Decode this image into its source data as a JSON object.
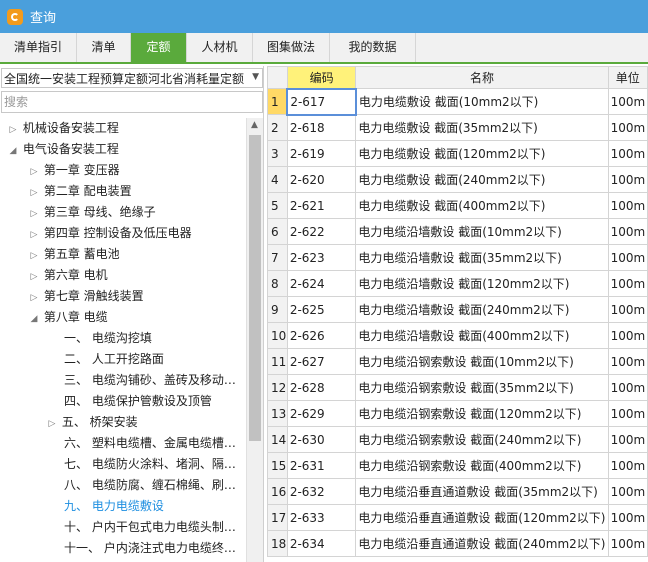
{
  "window": {
    "title": "查询"
  },
  "tabs": [
    {
      "label": "清单指引",
      "active": false
    },
    {
      "label": "清单",
      "active": false
    },
    {
      "label": "定额",
      "active": true
    },
    {
      "label": "人材机",
      "active": false
    },
    {
      "label": "图集做法",
      "active": false
    },
    {
      "label": "我的数据",
      "active": false
    }
  ],
  "left": {
    "combo_value": "全国统一安装工程预算定额河北省消耗量定额",
    "search_placeholder": "搜索",
    "tree": [
      {
        "label": "机械设备安装工程",
        "level": 0,
        "arrow": "▷"
      },
      {
        "label": "电气设备安装工程",
        "level": 0,
        "arrow": "◢"
      },
      {
        "label": "第一章  变压器",
        "level": 1,
        "arrow": "▷"
      },
      {
        "label": "第二章  配电装置",
        "level": 1,
        "arrow": "▷"
      },
      {
        "label": "第三章  母线、绝缘子",
        "level": 1,
        "arrow": "▷"
      },
      {
        "label": "第四章  控制设备及低压电器",
        "level": 1,
        "arrow": "▷"
      },
      {
        "label": "第五章  蓄电池",
        "level": 1,
        "arrow": "▷"
      },
      {
        "label": "第六章  电机",
        "level": 1,
        "arrow": "▷"
      },
      {
        "label": "第七章  滑触线装置",
        "level": 1,
        "arrow": "▷"
      },
      {
        "label": "第八章  电缆",
        "level": 1,
        "arrow": "◢"
      },
      {
        "label": "一、  电缆沟挖填",
        "level": 2,
        "arrow": ""
      },
      {
        "label": "二、  人工开挖路面",
        "level": 2,
        "arrow": ""
      },
      {
        "label": "三、  电缆沟铺砂、盖砖及移动…",
        "level": 2,
        "arrow": ""
      },
      {
        "label": "四、  电缆保护管敷设及顶管",
        "level": 2,
        "arrow": ""
      },
      {
        "label": "五、  桥架安装",
        "level": 2,
        "arrow": "▷"
      },
      {
        "label": "六、  塑料电缆槽、金属电缆槽…",
        "level": 2,
        "arrow": ""
      },
      {
        "label": "七、  电缆防火涂料、堵洞、隔…",
        "level": 2,
        "arrow": ""
      },
      {
        "label": "八、  电缆防腐、缠石棉绳、刷…",
        "level": 2,
        "arrow": ""
      },
      {
        "label": "九、  电力电缆敷设",
        "level": 2,
        "arrow": "",
        "selected": true
      },
      {
        "label": "十、  户内干包式电力电缆头制…",
        "level": 2,
        "arrow": ""
      },
      {
        "label": "十一、  户内浇注式电力电缆终…",
        "level": 2,
        "arrow": ""
      }
    ]
  },
  "grid": {
    "headers": {
      "rownum": "",
      "code": "编码",
      "name": "名称",
      "unit": "单位"
    },
    "rows": [
      {
        "n": "1",
        "code": "2-617",
        "name": "电力电缆敷设 截面(10mm2以下)",
        "unit": "100m",
        "active": true
      },
      {
        "n": "2",
        "code": "2-618",
        "name": "电力电缆敷设 截面(35mm2以下)",
        "unit": "100m"
      },
      {
        "n": "3",
        "code": "2-619",
        "name": "电力电缆敷设 截面(120mm2以下)",
        "unit": "100m"
      },
      {
        "n": "4",
        "code": "2-620",
        "name": "电力电缆敷设 截面(240mm2以下)",
        "unit": "100m"
      },
      {
        "n": "5",
        "code": "2-621",
        "name": "电力电缆敷设 截面(400mm2以下)",
        "unit": "100m"
      },
      {
        "n": "6",
        "code": "2-622",
        "name": "电力电缆沿墙敷设 截面(10mm2以下)",
        "unit": "100m"
      },
      {
        "n": "7",
        "code": "2-623",
        "name": "电力电缆沿墙敷设 截面(35mm2以下)",
        "unit": "100m"
      },
      {
        "n": "8",
        "code": "2-624",
        "name": "电力电缆沿墙敷设 截面(120mm2以下)",
        "unit": "100m"
      },
      {
        "n": "9",
        "code": "2-625",
        "name": "电力电缆沿墙敷设 截面(240mm2以下)",
        "unit": "100m"
      },
      {
        "n": "10",
        "code": "2-626",
        "name": "电力电缆沿墙敷设 截面(400mm2以下)",
        "unit": "100m"
      },
      {
        "n": "11",
        "code": "2-627",
        "name": "电力电缆沿钢索敷设 截面(10mm2以下)",
        "unit": "100m"
      },
      {
        "n": "12",
        "code": "2-628",
        "name": "电力电缆沿钢索敷设 截面(35mm2以下)",
        "unit": "100m"
      },
      {
        "n": "13",
        "code": "2-629",
        "name": "电力电缆沿钢索敷设 截面(120mm2以下)",
        "unit": "100m"
      },
      {
        "n": "14",
        "code": "2-630",
        "name": "电力电缆沿钢索敷设 截面(240mm2以下)",
        "unit": "100m"
      },
      {
        "n": "15",
        "code": "2-631",
        "name": "电力电缆沿钢索敷设 截面(400mm2以下)",
        "unit": "100m"
      },
      {
        "n": "16",
        "code": "2-632",
        "name": "电力电缆沿垂直通道敷设 截面(35mm2以下)",
        "unit": "100m"
      },
      {
        "n": "17",
        "code": "2-633",
        "name": "电力电缆沿垂直通道敷设 截面(120mm2以下)",
        "unit": "100m"
      },
      {
        "n": "18",
        "code": "2-634",
        "name": "电力电缆沿垂直通道敷设 截面(240mm2以下)",
        "unit": "100m"
      }
    ]
  }
}
